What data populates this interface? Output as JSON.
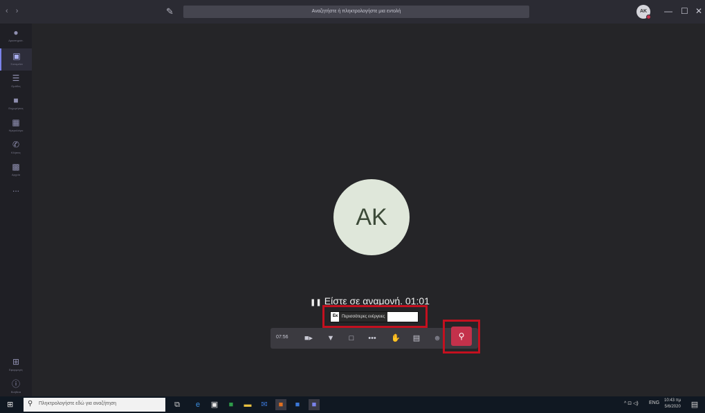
{
  "titlebar": {
    "nav": "‹ ›",
    "search_placeholder": "Αναζητήστε ή πληκτρολογήστε μια εντολή",
    "avatar_initials": "AK",
    "min": "—",
    "max": "☐",
    "close": "✕"
  },
  "rail": {
    "items": [
      {
        "label": "Δραστηριότ.",
        "icon": "bell-icon"
      },
      {
        "label": "Συνομιλία",
        "icon": "chat-icon"
      },
      {
        "label": "Ομάδες",
        "icon": "teams-icon"
      },
      {
        "label": "Εκχωρήσεις",
        "icon": "assignments-icon"
      },
      {
        "label": "Ημερολόγιο",
        "icon": "calendar-icon"
      },
      {
        "label": "Κλήσεις",
        "icon": "phone-icon"
      },
      {
        "label": "Αρχεία",
        "icon": "files-icon"
      },
      {
        "label": "...",
        "icon": "more-icon"
      },
      {
        "label": "Εφαρμογές",
        "icon": "apps-icon"
      },
      {
        "label": "Βοήθεια",
        "icon": "help-icon"
      }
    ]
  },
  "call": {
    "avatar_initials": "AK",
    "hold_status": "Είστε σε αναμονή. 01:01",
    "tooltip_under": "Εκ",
    "tooltip": "Περισσότερες ενέργειες",
    "duration": "07:56"
  },
  "taskbar": {
    "search_placeholder": "Πληκτρολογήστε εδώ για αναζήτηση",
    "tray_lang": "ENG",
    "tray_icons": "^ ⊡ ◁)",
    "time": "10:43 πμ",
    "date": "5/6/2020"
  }
}
